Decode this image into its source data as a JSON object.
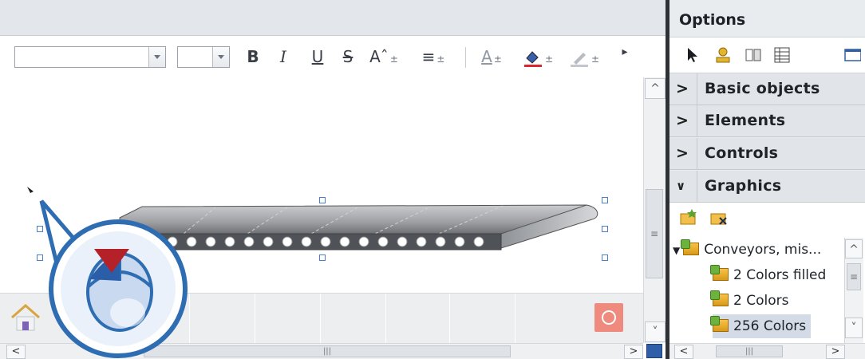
{
  "toolbar": {
    "bold": "B",
    "italic": "I",
    "underline": "U",
    "strike": "S",
    "fontsize": "Aˆ",
    "align": "≡",
    "textcolor": "A",
    "more": "▸",
    "pm": "±"
  },
  "options": {
    "title": "Options",
    "sections": [
      {
        "label": "Basic objects",
        "expanded": false
      },
      {
        "label": "Elements",
        "expanded": false
      },
      {
        "label": "Controls",
        "expanded": false
      },
      {
        "label": "Graphics",
        "expanded": true
      }
    ],
    "tree": {
      "folder": "Conveyors, mis...",
      "items": [
        "2 Colors filled",
        "2 Colors",
        "256 Colors"
      ],
      "selected_index": 2
    }
  },
  "scroll": {
    "up": "^",
    "down": "˅",
    "left": "<",
    "right": ">",
    "grip_v": "≡",
    "grip_h": "|||"
  },
  "colors": {
    "accent": "#4a7fd0",
    "power": "#ef8a7e",
    "callout": "#2f6db3"
  }
}
